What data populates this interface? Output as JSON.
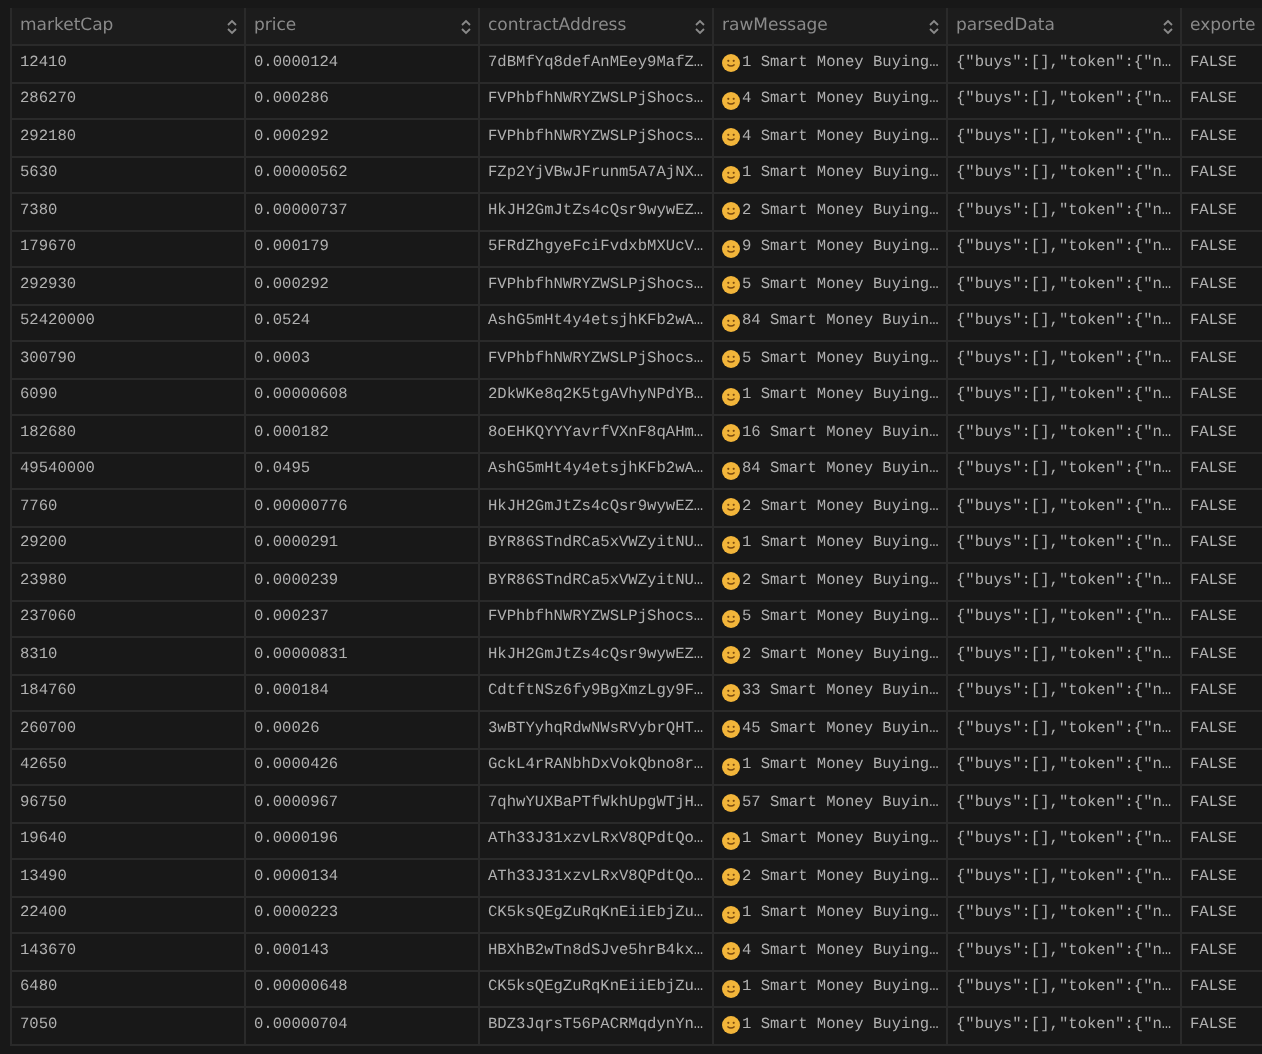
{
  "table": {
    "columns": [
      {
        "label": "marketCap",
        "sortable": true
      },
      {
        "label": "price",
        "sortable": true
      },
      {
        "label": "contractAddress",
        "sortable": true
      },
      {
        "label": "rawMessage",
        "sortable": true
      },
      {
        "label": "parsedData",
        "sortable": true
      },
      {
        "label": "exporte",
        "sortable": false
      }
    ],
    "rows": [
      {
        "market_cap": "12410",
        "price": "0.0000124",
        "contract_address": "7dBMfYq8defAnMEey9MafZ…",
        "raw_message": "1 Smart Money Buying…",
        "parsed_data": "{\"buys\":[],\"token\":{\"n…",
        "exported": "FALSE"
      },
      {
        "market_cap": "286270",
        "price": "0.000286",
        "contract_address": "FVPhbfhNWRYZWSLPjShocs…",
        "raw_message": "4 Smart Money Buying…",
        "parsed_data": "{\"buys\":[],\"token\":{\"n…",
        "exported": "FALSE"
      },
      {
        "market_cap": "292180",
        "price": "0.000292",
        "contract_address": "FVPhbfhNWRYZWSLPjShocs…",
        "raw_message": "4 Smart Money Buying…",
        "parsed_data": "{\"buys\":[],\"token\":{\"n…",
        "exported": "FALSE"
      },
      {
        "market_cap": "5630",
        "price": "0.00000562",
        "contract_address": "FZp2YjVBwJFrunm5A7AjNX…",
        "raw_message": "1 Smart Money Buying…",
        "parsed_data": "{\"buys\":[],\"token\":{\"n…",
        "exported": "FALSE"
      },
      {
        "market_cap": "7380",
        "price": "0.00000737",
        "contract_address": "HkJH2GmJtZs4cQsr9wywEZ…",
        "raw_message": "2 Smart Money Buying…",
        "parsed_data": "{\"buys\":[],\"token\":{\"n…",
        "exported": "FALSE"
      },
      {
        "market_cap": "179670",
        "price": "0.000179",
        "contract_address": "5FRdZhgyeFciFvdxbMXUcV…",
        "raw_message": "9 Smart Money Buying…",
        "parsed_data": "{\"buys\":[],\"token\":{\"n…",
        "exported": "FALSE"
      },
      {
        "market_cap": "292930",
        "price": "0.000292",
        "contract_address": "FVPhbfhNWRYZWSLPjShocs…",
        "raw_message": "5 Smart Money Buying…",
        "parsed_data": "{\"buys\":[],\"token\":{\"n…",
        "exported": "FALSE"
      },
      {
        "market_cap": "52420000",
        "price": "0.0524",
        "contract_address": "AshG5mHt4y4etsjhKFb2wA…",
        "raw_message": "84 Smart Money Buyin…",
        "parsed_data": "{\"buys\":[],\"token\":{\"n…",
        "exported": "FALSE"
      },
      {
        "market_cap": "300790",
        "price": "0.0003",
        "contract_address": "FVPhbfhNWRYZWSLPjShocs…",
        "raw_message": "5 Smart Money Buying…",
        "parsed_data": "{\"buys\":[],\"token\":{\"n…",
        "exported": "FALSE"
      },
      {
        "market_cap": "6090",
        "price": "0.00000608",
        "contract_address": "2DkWKe8q2K5tgAVhyNPdYB…",
        "raw_message": "1 Smart Money Buying…",
        "parsed_data": "{\"buys\":[],\"token\":{\"n…",
        "exported": "FALSE"
      },
      {
        "market_cap": "182680",
        "price": "0.000182",
        "contract_address": "8oEHKQYYYavrfVXnF8qAHm…",
        "raw_message": "16 Smart Money Buyin…",
        "parsed_data": "{\"buys\":[],\"token\":{\"n…",
        "exported": "FALSE"
      },
      {
        "market_cap": "49540000",
        "price": "0.0495",
        "contract_address": "AshG5mHt4y4etsjhKFb2wA…",
        "raw_message": "84 Smart Money Buyin…",
        "parsed_data": "{\"buys\":[],\"token\":{\"n…",
        "exported": "FALSE"
      },
      {
        "market_cap": "7760",
        "price": "0.00000776",
        "contract_address": "HkJH2GmJtZs4cQsr9wywEZ…",
        "raw_message": "2 Smart Money Buying…",
        "parsed_data": "{\"buys\":[],\"token\":{\"n…",
        "exported": "FALSE"
      },
      {
        "market_cap": "29200",
        "price": "0.0000291",
        "contract_address": "BYR86STndRCa5xVWZyitNU…",
        "raw_message": "1 Smart Money Buying…",
        "parsed_data": "{\"buys\":[],\"token\":{\"n…",
        "exported": "FALSE"
      },
      {
        "market_cap": "23980",
        "price": "0.0000239",
        "contract_address": "BYR86STndRCa5xVWZyitNU…",
        "raw_message": "2 Smart Money Buying…",
        "parsed_data": "{\"buys\":[],\"token\":{\"n…",
        "exported": "FALSE"
      },
      {
        "market_cap": "237060",
        "price": "0.000237",
        "contract_address": "FVPhbfhNWRYZWSLPjShocs…",
        "raw_message": "5 Smart Money Buying…",
        "parsed_data": "{\"buys\":[],\"token\":{\"n…",
        "exported": "FALSE"
      },
      {
        "market_cap": "8310",
        "price": "0.00000831",
        "contract_address": "HkJH2GmJtZs4cQsr9wywEZ…",
        "raw_message": "2 Smart Money Buying…",
        "parsed_data": "{\"buys\":[],\"token\":{\"n…",
        "exported": "FALSE"
      },
      {
        "market_cap": "184760",
        "price": "0.000184",
        "contract_address": "CdtftNSz6fy9BgXmzLgy9F…",
        "raw_message": "33 Smart Money Buyin…",
        "parsed_data": "{\"buys\":[],\"token\":{\"n…",
        "exported": "FALSE"
      },
      {
        "market_cap": "260700",
        "price": "0.00026",
        "contract_address": "3wBTYyhqRdwNWsRVybrQHT…",
        "raw_message": "45 Smart Money Buyin…",
        "parsed_data": "{\"buys\":[],\"token\":{\"n…",
        "exported": "FALSE"
      },
      {
        "market_cap": "42650",
        "price": "0.0000426",
        "contract_address": "GckL4rRANbhDxVokQbno8r…",
        "raw_message": "1 Smart Money Buying…",
        "parsed_data": "{\"buys\":[],\"token\":{\"n…",
        "exported": "FALSE"
      },
      {
        "market_cap": "96750",
        "price": "0.0000967",
        "contract_address": "7qhwYUXBaPTfWkhUpgWTjH…",
        "raw_message": "57 Smart Money Buyin…",
        "parsed_data": "{\"buys\":[],\"token\":{\"n…",
        "exported": "FALSE"
      },
      {
        "market_cap": "19640",
        "price": "0.0000196",
        "contract_address": "ATh33J31xzvLRxV8QPdtQo…",
        "raw_message": "1 Smart Money Buying…",
        "parsed_data": "{\"buys\":[],\"token\":{\"n…",
        "exported": "FALSE"
      },
      {
        "market_cap": "13490",
        "price": "0.0000134",
        "contract_address": "ATh33J31xzvLRxV8QPdtQo…",
        "raw_message": "2 Smart Money Buying…",
        "parsed_data": "{\"buys\":[],\"token\":{\"n…",
        "exported": "FALSE"
      },
      {
        "market_cap": "22400",
        "price": "0.0000223",
        "contract_address": "CK5ksQEgZuRqKnEiiEbjZu…",
        "raw_message": "1 Smart Money Buying…",
        "parsed_data": "{\"buys\":[],\"token\":{\"n…",
        "exported": "FALSE"
      },
      {
        "market_cap": "143670",
        "price": "0.000143",
        "contract_address": "HBXhB2wTn8dSJve5hrB4kx…",
        "raw_message": "4 Smart Money Buying…",
        "parsed_data": "{\"buys\":[],\"token\":{\"n…",
        "exported": "FALSE"
      },
      {
        "market_cap": "6480",
        "price": "0.00000648",
        "contract_address": "CK5ksQEgZuRqKnEiiEbjZu…",
        "raw_message": "1 Smart Money Buying…",
        "parsed_data": "{\"buys\":[],\"token\":{\"n…",
        "exported": "FALSE"
      },
      {
        "market_cap": "7050",
        "price": "0.00000704",
        "contract_address": "BDZ3JqrsT56PACRMqdynYn…",
        "raw_message": "1 Smart Money Buying…",
        "parsed_data": "{\"buys\":[],\"token\":{\"n…",
        "exported": "FALSE"
      }
    ]
  }
}
